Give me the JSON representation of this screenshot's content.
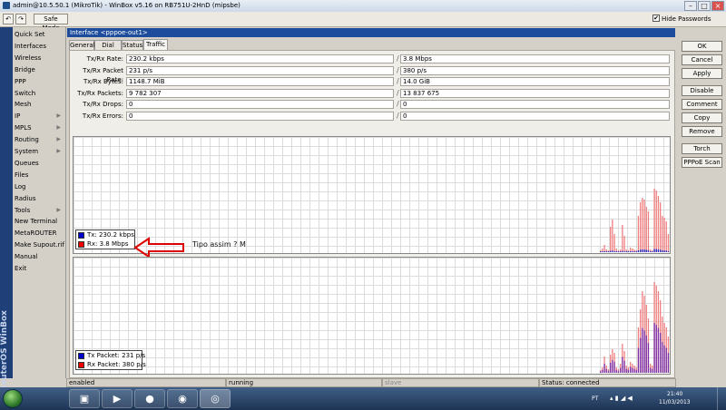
{
  "window": {
    "title": "admin@10.5.50.1 (MikroTik) - WinBox v5.16 on RB751U-2HnD (mipsbe)",
    "controls": [
      "minimize-icon",
      "maximize-icon",
      "close-icon"
    ]
  },
  "toolbar": {
    "undo_icon": "undo-icon",
    "redo_icon": "redo-icon",
    "safe_mode_label": "Safe Mode",
    "hide_passwords_label": "Hide Passwords",
    "hide_passwords_checked": true
  },
  "sidebar": {
    "brand_text": "RouterOS WinBox",
    "items": [
      {
        "label": "Quick Set",
        "submenu": false
      },
      {
        "label": "Interfaces",
        "submenu": false
      },
      {
        "label": "Wireless",
        "submenu": false
      },
      {
        "label": "Bridge",
        "submenu": false
      },
      {
        "label": "PPP",
        "submenu": false
      },
      {
        "label": "Switch",
        "submenu": false
      },
      {
        "label": "Mesh",
        "submenu": false
      },
      {
        "label": "IP",
        "submenu": true
      },
      {
        "label": "MPLS",
        "submenu": true
      },
      {
        "label": "Routing",
        "submenu": true
      },
      {
        "label": "System",
        "submenu": true
      },
      {
        "label": "Queues",
        "submenu": false
      },
      {
        "label": "Files",
        "submenu": false
      },
      {
        "label": "Log",
        "submenu": false
      },
      {
        "label": "Radius",
        "submenu": false
      },
      {
        "label": "Tools",
        "submenu": true
      },
      {
        "label": "New Terminal",
        "submenu": false
      },
      {
        "label": "MetaROUTER",
        "submenu": false
      },
      {
        "label": "Make Supout.rif",
        "submenu": false
      },
      {
        "label": "Manual",
        "submenu": false
      },
      {
        "label": "Exit",
        "submenu": false
      }
    ]
  },
  "dialog": {
    "title": "Interface <pppoe-out1>",
    "tabs": [
      "General",
      "Dial Out",
      "Status",
      "Traffic"
    ],
    "active_tab": "Traffic",
    "fields": [
      {
        "label": "Tx/Rx Rate:",
        "tx": "230.2 kbps",
        "rx": "3.8 Mbps"
      },
      {
        "label": "Tx/Rx Packet Rate:",
        "tx": "231 p/s",
        "rx": "380 p/s"
      },
      {
        "label": "Tx/Rx Bytes:",
        "tx": "1148.7 MiB",
        "rx": "14.0 GiB"
      },
      {
        "label": "Tx/Rx Packets:",
        "tx": "9 782 307",
        "rx": "13 837 675"
      },
      {
        "label": "Tx/Rx Drops:",
        "tx": "0",
        "rx": "0"
      },
      {
        "label": "Tx/Rx Errors:",
        "tx": "0",
        "rx": "0"
      }
    ],
    "separator": "/",
    "traffic_graph": {
      "legend": [
        {
          "label": "Tx:  230.2 kbps",
          "color": "#0000cc"
        },
        {
          "label": "Rx:  3.8 Mbps",
          "color": "#ee0000"
        }
      ]
    },
    "packet_graph": {
      "legend": [
        {
          "label": "Tx Packet:  231 p/s",
          "color": "#0000cc"
        },
        {
          "label": "Rx Packet:  380 p/s",
          "color": "#ee0000"
        }
      ]
    },
    "annotation_text": "Tipo assim ? M",
    "annotation_color": "#dd0000",
    "buttons": [
      "OK",
      "Cancel",
      "Apply",
      "Disable",
      "Comment",
      "Copy",
      "Remove",
      "Torch",
      "PPPoE Scan"
    ],
    "status_bar": [
      "enabled",
      "running",
      "slave",
      "Status: connected"
    ]
  },
  "taskbar": {
    "apps": [
      "explorer-icon",
      "media-player-icon",
      "firefox-icon",
      "chrome-icon",
      "winbox-icon"
    ],
    "language": "PT",
    "time": "21:40",
    "date": "11/03/2013"
  }
}
